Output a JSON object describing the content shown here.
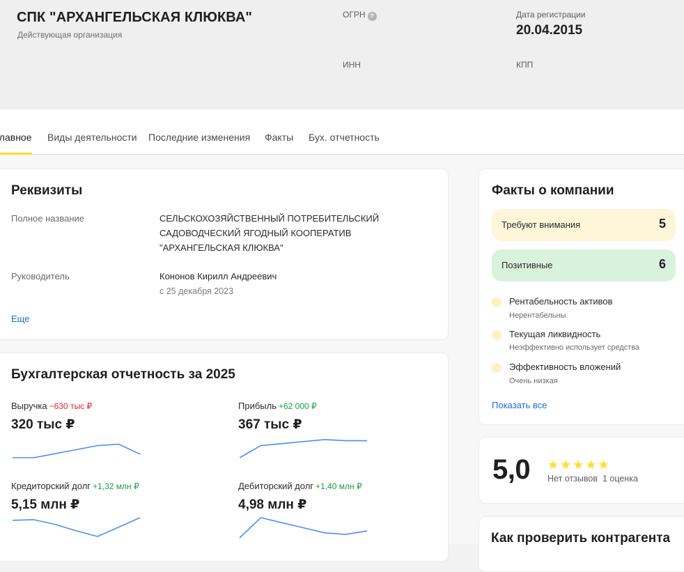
{
  "company": {
    "name": "СПК \"АРХАНГЕЛЬСКАЯ КЛЮКВА\"",
    "status": "Действующая организация",
    "ogrn_label": "ОГРН",
    "inn_label": "ИНН",
    "reg_date_label": "Дата регистрации",
    "reg_date": "20.04.2015",
    "kpp_label": "КПП"
  },
  "tabs": [
    "Главное",
    "Виды деятельности",
    "Последние изменения",
    "Факты",
    "Бух. отчетность"
  ],
  "requisites": {
    "title": "Реквизиты",
    "full_name_label": "Полное название",
    "full_name_lines": [
      "СЕЛЬСКОХОЗЯЙСТВЕННЫЙ ПОТРЕБИТЕЛЬСКИЙ",
      "САДОВОДЧЕСКИЙ ЯГОДНЫЙ КООПЕРАТИВ",
      "\"АРХАНГЕЛЬСКАЯ КЛЮКВА\""
    ],
    "director_label": "Руководитель",
    "director_name": "Кононов Кирилл Андреевич",
    "director_since": "с 25 декабря 2023",
    "more_link": "Еще"
  },
  "accounting": {
    "title": "Бухгалтерская отчетность за 2025",
    "metrics": [
      {
        "label": "Выручка",
        "delta": "−630 тыс ₽",
        "delta_sign": "neg",
        "value": "320 тыс ₽",
        "trend": [
          0.0,
          0.0,
          0.2,
          0.4,
          0.6,
          0.67,
          0.18
        ]
      },
      {
        "label": "Прибыль",
        "delta": "+62 000 ₽",
        "delta_sign": "pos",
        "value": "367 тыс ₽",
        "trend": [
          0.0,
          0.6,
          0.7,
          0.8,
          0.9,
          0.84,
          0.84
        ]
      },
      {
        "label": "Кредиторский долг",
        "delta": "+1,32 млн ₽",
        "delta_sign": "pos",
        "value": "5,15 млн ₽",
        "trend": [
          0.87,
          0.9,
          0.67,
          0.35,
          0.07,
          0.53,
          1.0
        ]
      },
      {
        "label": "Дебиторский долг",
        "delta": "+1,40 млн ₽",
        "delta_sign": "pos",
        "value": "4,98 млн ₽",
        "trend": [
          0.0,
          1.0,
          0.75,
          0.5,
          0.25,
          0.17,
          0.35
        ]
      }
    ]
  },
  "facts": {
    "title": "Факты о компании",
    "attention_label": "Требуют внимания",
    "attention_count": "5",
    "positive_label": "Позитивные",
    "positive_count": "6",
    "items": [
      {
        "title": "Рентабельность активов",
        "sub": "Нерентабельны"
      },
      {
        "title": "Текущая ликвидность",
        "sub": "Неэффективно использует средства"
      },
      {
        "title": "Эффективность вложений",
        "sub": "Очень низкая"
      }
    ],
    "show_all": "Показать все",
    "colors": {
      "attention_bg": "#fdf6d8",
      "positive_bg": "#d9f2dc",
      "dot": "#fdf1c4"
    }
  },
  "rating": {
    "value": "5,0",
    "stars": 5,
    "stars_glyph": "★★★★★",
    "no_reviews": "Нет отзывов",
    "ratings_count": "1 оценка"
  },
  "check": {
    "title": "Как проверить контрагента"
  },
  "colors": {
    "accent": "#ffdd2d",
    "link": "#1e6ad8",
    "negative": "#e1232b",
    "positive": "#16a03f",
    "sparkline": "#4d8ff0"
  }
}
